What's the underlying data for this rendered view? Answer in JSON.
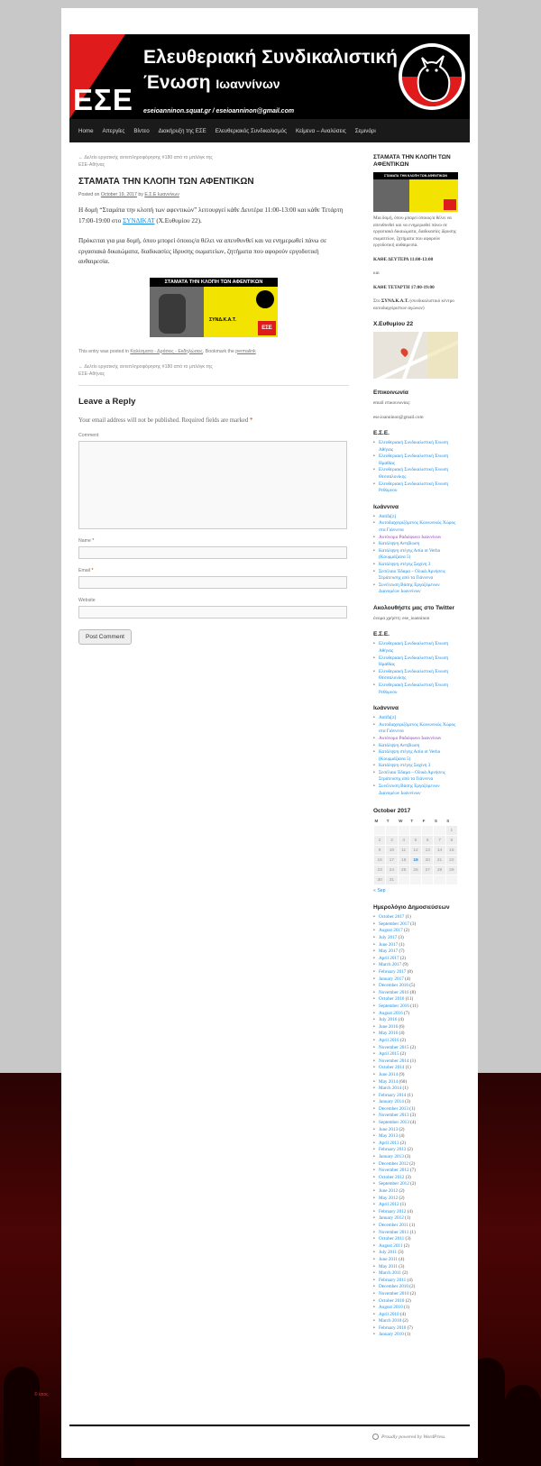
{
  "header": {
    "banner_letters": "ΕΣΕ",
    "banner_line1": "Ελευθεριακή Συνδικαλιστική",
    "banner_line2_big": "Ένωση",
    "banner_line2_small": "Ιωαννίνων",
    "banner_emails": "eseioanninon.squat.gr / eseioanninon@gmail.com",
    "colors": {
      "red": "#e01b1b",
      "black": "#000000"
    }
  },
  "nav": {
    "items": [
      "Home",
      "Απεργίες",
      "Βίντεο",
      "Διακήρυξη της ΕΣΕ",
      "Ελευθεριακός Συνδικαλισμός",
      "Κείμενα – Αναλύσεις",
      "Σεμινάρι"
    ]
  },
  "post": {
    "nav_prev_top": "← Δελτίο εργατικής αντεπληροφόρησης #180 από το μπλόγκ της ΕΣΕ-Αθήνας",
    "title": "ΣΤΑΜΑΤΑ ΤΗΝ ΚΛΟΠΗ ΤΩΝ ΑΦΕΝΤΙΚΩΝ",
    "meta": {
      "posted_on": "Posted on",
      "date": "October 19, 2017",
      "by": "by",
      "author": "Ε.Σ.Ε Ιωαννίνων"
    },
    "para1_pre": "Η δομή “Σταμάτα την κλοπή των αφεντικών” λειτουργεί κάθε Δευτέρα 11:00-13:00 και κάθε Τετάρτη 17:00-19:00 στο ",
    "para1_link": "ΣΥΝΔΙΚΑΤ",
    "para1_post": " (Χ.Ευθυμίου 22).",
    "para2": "Πρόκειται για μια δομή, όπου μπορεί όποιος/α θέλει να απευθυνθεί και να ενημερωθεί πάνω σε εργασιακά δικαιώματα, διαδικασίες ίδρυσης σωματείων, ζητήματα που αφορούν εργοδοτική αυθαιρεσία.",
    "image_caption": "ΣΤΑΜΑΤΑ ΤΗΝ ΚΛΟΠΗ ΤΩΝ ΑΦΕΝΤΙΚΩΝ",
    "image_subtext": "ΣΥΝΔ.Κ.Α.Τ.",
    "image_logo": "ΕΣΕ",
    "footer_pre": "This entry was posted in",
    "footer_category": "Καλέσματα - Δράσεις - Εκδηλώσεις",
    "footer_mid": ". Bookmark the",
    "footer_permalink": "permalink",
    "nav_prev_bottom": "← Δελτίο εργατικής αντεπληροφόρησης #180 από το μπλόγκ της ΕΣΕ-Αθήνας"
  },
  "reply": {
    "title": "Leave a Reply",
    "notes": "Your email address will not be published. Required fields are marked",
    "required_mark": "*",
    "comment_label": "Comment",
    "name_label": "Name",
    "email_label": "Email",
    "website_label": "Website",
    "comment_value": "",
    "name_value": "",
    "email_value": "",
    "website_value": "",
    "submit_label": "Post Comment"
  },
  "sidebar": {
    "stop_title": "ΣΤΑΜΑΤΑ ΤΗΝ ΚΛΟΠΗ ΤΩΝ ΑΦΕΝΤΙΚΩΝ",
    "stop_text": "Μια δομή, όπου μπορεί όποιος/α θέλει να απευθυνθεί και να ενημερωθεί πάνω σε εργασιακά δικαιώματα, διαδικασίες ίδρυσης σωματείων, ζητήματα που αφορούν εργοδοτική αυθαιρεσία.",
    "monday": "ΚΑΘΕ ΔΕΥΤΕΡΑ 11:00-13:00",
    "and": "και",
    "wednesday": "ΚΑΘΕ ΤΕΤΑΡΤΗ 17:00-19:00",
    "place_pre": "Στο",
    "place_bold": "ΣΥΝΔ.Κ.Α.Τ.",
    "place_post": "(συνδικαλιστικό κέντρο αυτοδιαχείριστων αγώνων)",
    "map_title": "Χ.Ευθυμίου 22",
    "contact_title": "Επικοινωνία",
    "contact_line1": "email επικοινωνίας:",
    "contact_line2": "ese.ioanninon@gmail.com",
    "ese_title": "Ε.Σ.Ε.",
    "ese_links": [
      "Ελευθεριακή Συνδικαλιστική Ένωση Αθήνας",
      "Ελευθεριακή Συνδικαλιστική Ένωση Ημαθίας",
      "Ελευθεριακή Συνδικαλιστική Ένωση Θεσσαλονίκης",
      "Ελευθεριακή Συνδικαλιστική Ένωση Ρεθύμνου"
    ],
    "ioannina_title": "Ιωάννινα",
    "ioannina_links": [
      "Antifa[z]",
      "Αυτοδιαχειριζόμενος Κοινωνικός Χώρος στα Γιάννενα",
      "Αυτόνομο Ραδιόφωνο Ιωαννίνων",
      "Κατάληψη Αντιβίωση",
      "Κατάληψη στέγης Ασία ot Verba (Κουρμάζιανα 5)",
      "Κατάληψη στέγης Σαχίνη 3",
      "Σεσέλαιο Έδαμα – Ολικά Αρνήσεις Στράτευσης από τα Γιάννενα",
      "Συνέλευση Βάσης Εργαζόμενων Διανομέων Ιωαννίνων"
    ],
    "twitter_title": "Ακολουθήστε μας στο Twitter",
    "twitter_text": "όνομα χρήστη: ese_ioanninon",
    "ese2_title": "Ε.Σ.Ε.",
    "ioannina2_title": "Ιωάννινα",
    "calendar": {
      "title": "October 2017",
      "weekdays": [
        "M",
        "T",
        "W",
        "T",
        "F",
        "S",
        "S"
      ],
      "rows": [
        [
          "",
          "",
          "",
          "",
          "",
          "",
          "1"
        ],
        [
          "2",
          "3",
          "4",
          "5",
          "6",
          "7",
          "8"
        ],
        [
          "9",
          "10",
          "11",
          "12",
          "13",
          "14",
          "15"
        ],
        [
          "16",
          "17",
          "18",
          "19",
          "20",
          "21",
          "22"
        ],
        [
          "23",
          "24",
          "25",
          "26",
          "27",
          "28",
          "29"
        ],
        [
          "30",
          "31",
          "",
          "",
          "",
          "",
          ""
        ]
      ],
      "linked_day": "19",
      "prev": "« Sep"
    },
    "archive_title": "Ημερολόγιο Δημοσιεύσεων",
    "archives": [
      [
        "October 2017",
        "(1)"
      ],
      [
        "September 2017",
        "(3)"
      ],
      [
        "August 2017",
        "(2)"
      ],
      [
        "July 2017",
        "(3)"
      ],
      [
        "June 2017",
        "(1)"
      ],
      [
        "May 2017",
        "(7)"
      ],
      [
        "April 2017",
        "(2)"
      ],
      [
        "March 2017",
        "(9)"
      ],
      [
        "February 2017",
        "(8)"
      ],
      [
        "January 2017",
        "(4)"
      ],
      [
        "December 2016",
        "(5)"
      ],
      [
        "November 2016",
        "(8)"
      ],
      [
        "October 2016",
        "(11)"
      ],
      [
        "September 2016",
        "(11)"
      ],
      [
        "August 2016",
        "(7)"
      ],
      [
        "July 2016",
        "(4)"
      ],
      [
        "June 2016",
        "(6)"
      ],
      [
        "May 2016",
        "(4)"
      ],
      [
        "April 2016",
        "(2)"
      ],
      [
        "November 2015",
        "(2)"
      ],
      [
        "April 2015",
        "(2)"
      ],
      [
        "November 2014",
        "(1)"
      ],
      [
        "October 2014",
        "(1)"
      ],
      [
        "June 2014",
        "(9)"
      ],
      [
        "May 2014",
        "(60)"
      ],
      [
        "March 2014",
        "(1)"
      ],
      [
        "February 2014",
        "(1)"
      ],
      [
        "January 2014",
        "(3)"
      ],
      [
        "December 2013",
        "(1)"
      ],
      [
        "November 2013",
        "(3)"
      ],
      [
        "September 2013",
        "(4)"
      ],
      [
        "June 2013",
        "(2)"
      ],
      [
        "May 2013",
        "(4)"
      ],
      [
        "April 2013",
        "(2)"
      ],
      [
        "February 2013",
        "(2)"
      ],
      [
        "January 2013",
        "(3)"
      ],
      [
        "December 2012",
        "(2)"
      ],
      [
        "November 2012",
        "(7)"
      ],
      [
        "October 2012",
        "(3)"
      ],
      [
        "September 2012",
        "(2)"
      ],
      [
        "June 2012",
        "(2)"
      ],
      [
        "May 2012",
        "(2)"
      ],
      [
        "April 2012",
        "(1)"
      ],
      [
        "February 2012",
        "(4)"
      ],
      [
        "January 2012",
        "(1)"
      ],
      [
        "December 2011",
        "(1)"
      ],
      [
        "November 2011",
        "(1)"
      ],
      [
        "October 2011",
        "(3)"
      ],
      [
        "August 2011",
        "(2)"
      ],
      [
        "July 2011",
        "(3)"
      ],
      [
        "June 2011",
        "(4)"
      ],
      [
        "May 2011",
        "(3)"
      ],
      [
        "March 2011",
        "(2)"
      ],
      [
        "February 2011",
        "(4)"
      ],
      [
        "December 2010",
        "(2)"
      ],
      [
        "November 2010",
        "(2)"
      ],
      [
        "October 2010",
        "(2)"
      ],
      [
        "August 2010",
        "(1)"
      ],
      [
        "April 2010",
        "(4)"
      ],
      [
        "March 2010",
        "(2)"
      ],
      [
        "February 2010",
        "(7)"
      ],
      [
        "January 2010",
        "(1)"
      ]
    ]
  },
  "footer": {
    "credit": "Proudly powered by WordPress."
  },
  "background": {
    "bottom_text": "© ίσιος"
  }
}
